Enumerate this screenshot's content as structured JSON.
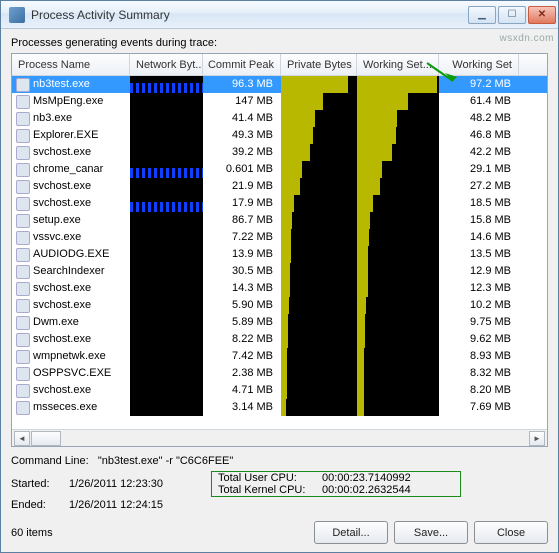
{
  "window": {
    "title": "Process Activity Summary"
  },
  "subtitle": "Processes generating events during trace:",
  "columns": {
    "name": "Process Name",
    "net": "Network Byt...",
    "commit": "Commit Peak",
    "priv": "Private Bytes",
    "wsgraph": "Working Set...",
    "ws": "Working Set"
  },
  "rows": [
    {
      "name": "nb3test.exe",
      "commit": "96.3 MB",
      "ws": "97.2 MB",
      "wsfill": 98,
      "sel": true,
      "net_blue": true
    },
    {
      "name": "MsMpEng.exe",
      "commit": "147 MB",
      "ws": "61.4 MB",
      "wsfill": 62,
      "net_blue": false
    },
    {
      "name": "nb3.exe",
      "commit": "41.4 MB",
      "ws": "48.2 MB",
      "wsfill": 49,
      "net_blue": false
    },
    {
      "name": "Explorer.EXE",
      "commit": "49.3 MB",
      "ws": "46.8 MB",
      "wsfill": 47,
      "net_blue": false
    },
    {
      "name": "svchost.exe",
      "commit": "39.2 MB",
      "ws": "42.2 MB",
      "wsfill": 43,
      "net_blue": false
    },
    {
      "name": "chrome_canar",
      "commit": "0.601 MB",
      "ws": "29.1 MB",
      "wsfill": 30,
      "net_blue": true
    },
    {
      "name": "svchost.exe",
      "commit": "21.9 MB",
      "ws": "27.2 MB",
      "wsfill": 28,
      "net_blue": false
    },
    {
      "name": "svchost.exe",
      "commit": "17.9 MB",
      "ws": "18.5 MB",
      "wsfill": 19,
      "net_blue": true
    },
    {
      "name": "setup.exe",
      "commit": "86.7 MB",
      "ws": "15.8 MB",
      "wsfill": 16,
      "net_blue": false
    },
    {
      "name": "vssvc.exe",
      "commit": "7.22 MB",
      "ws": "14.6 MB",
      "wsfill": 15,
      "net_blue": false
    },
    {
      "name": "AUDIODG.EXE",
      "commit": "13.9 MB",
      "ws": "13.5 MB",
      "wsfill": 14,
      "net_blue": false
    },
    {
      "name": "SearchIndexer",
      "commit": "30.5 MB",
      "ws": "12.9 MB",
      "wsfill": 13,
      "net_blue": false
    },
    {
      "name": "svchost.exe",
      "commit": "14.3 MB",
      "ws": "12.3 MB",
      "wsfill": 13,
      "net_blue": false
    },
    {
      "name": "svchost.exe",
      "commit": "5.90 MB",
      "ws": "10.2 MB",
      "wsfill": 11,
      "net_blue": false
    },
    {
      "name": "Dwm.exe",
      "commit": "5.89 MB",
      "ws": "9.75 MB",
      "wsfill": 10,
      "net_blue": false
    },
    {
      "name": "svchost.exe",
      "commit": "8.22 MB",
      "ws": "9.62 MB",
      "wsfill": 10,
      "net_blue": false
    },
    {
      "name": "wmpnetwk.exe",
      "commit": "7.42 MB",
      "ws": "8.93 MB",
      "wsfill": 9,
      "net_blue": false
    },
    {
      "name": "OSPPSVC.EXE",
      "commit": "2.38 MB",
      "ws": "8.32 MB",
      "wsfill": 9,
      "net_blue": false
    },
    {
      "name": "svchost.exe",
      "commit": "4.71 MB",
      "ws": "8.20 MB",
      "wsfill": 9,
      "net_blue": false
    },
    {
      "name": "msseces.exe",
      "commit": "3.14 MB",
      "ws": "7.69 MB",
      "wsfill": 8,
      "net_blue": false
    }
  ],
  "cmdline": {
    "label": "Command Line:",
    "value": "\"nb3test.exe\" -r \"C6C6FEE\""
  },
  "started": {
    "label": "Started:",
    "value": "1/26/2011 12:23:30"
  },
  "ended": {
    "label": "Ended:",
    "value": "1/26/2011 12:24:15"
  },
  "user_cpu": {
    "label": "Total User CPU:",
    "value": "00:00:23.7140992"
  },
  "kernel_cpu": {
    "label": "Total Kernel CPU:",
    "value": "00:00:02.2632544"
  },
  "count": "60 items",
  "buttons": {
    "detail": "Detail...",
    "save": "Save...",
    "close": "Close"
  },
  "watermark": "wsxdn.com"
}
